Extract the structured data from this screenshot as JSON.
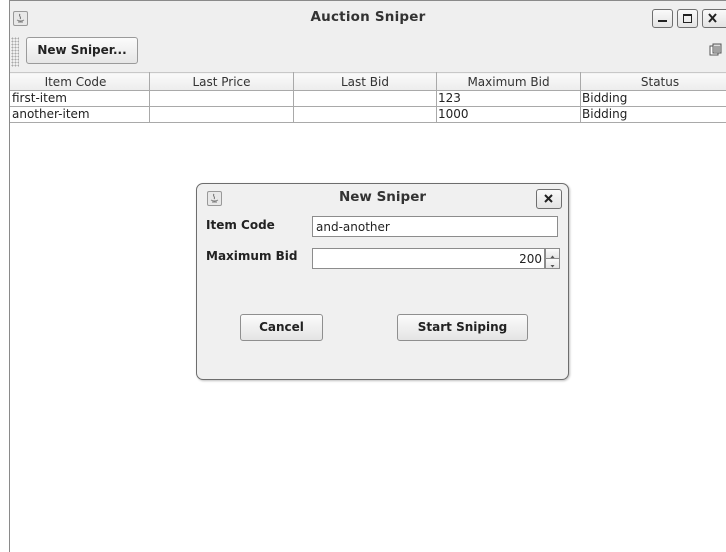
{
  "window": {
    "title": "Auction Sniper"
  },
  "toolbar": {
    "new_sniper_label": "New Sniper..."
  },
  "table": {
    "headers": [
      "Item Code",
      "Last Price",
      "Last Bid",
      "Maximum Bid",
      "Status"
    ],
    "rows": [
      [
        "first-item",
        "",
        "",
        "123",
        "Bidding"
      ],
      [
        "another-item",
        "",
        "",
        "1000",
        "Bidding"
      ]
    ]
  },
  "dialog": {
    "title": "New Sniper",
    "item_code_label": "Item Code",
    "item_code_value": "and-another",
    "max_bid_label": "Maximum Bid",
    "max_bid_value": "200",
    "cancel_label": "Cancel",
    "start_label": "Start Sniping"
  },
  "icons": {
    "app": "java-app-icon",
    "minimize": "minimize-icon",
    "maximize": "maximize-icon",
    "close": "close-icon",
    "toolbar_overflow": "toolbar-overflow-icon",
    "spin_up": "spinner-up-icon",
    "spin_down": "spinner-down-icon"
  }
}
